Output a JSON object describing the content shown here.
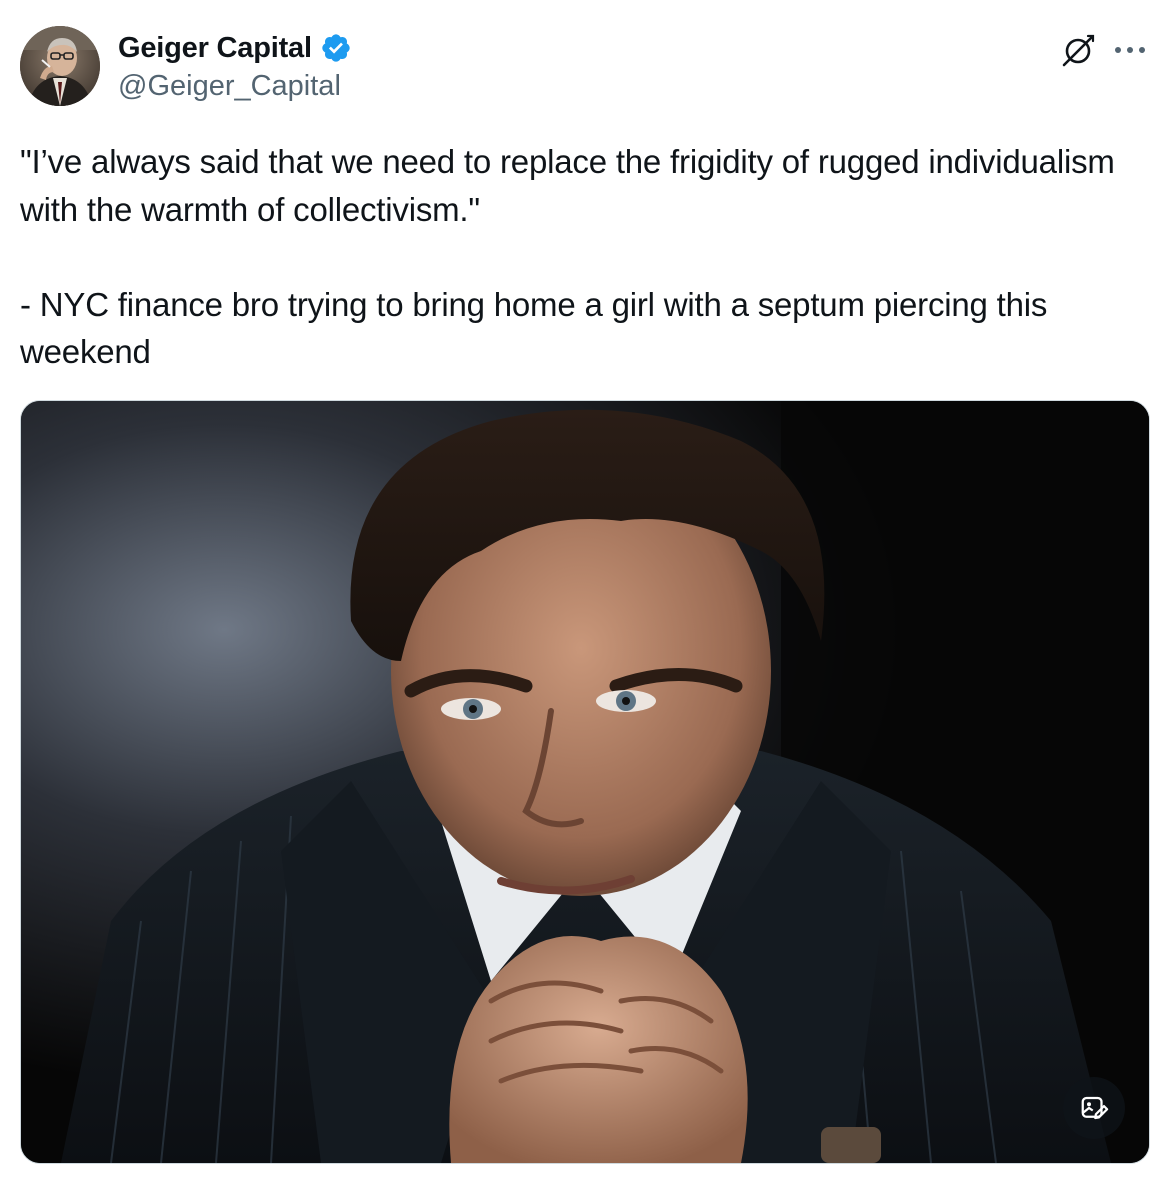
{
  "author": {
    "display_name": "Geiger Capital",
    "handle": "@Geiger_Capital",
    "verified": true,
    "verified_color": "#1d9bf0"
  },
  "header_actions": {
    "grok_icon": "grok-icon",
    "more_icon": "more-options-icon"
  },
  "tweet": {
    "text": "\"I’ve always said that we need to replace the frigidity of rugged individualism with the warmth of collectivism.\"\n\n- NYC finance bro trying to bring home a girl with a septum piercing this weekend"
  },
  "media": {
    "type": "photo",
    "alt_button_icon": "image-edit-icon"
  },
  "colors": {
    "text_primary": "#0f1419",
    "text_secondary": "#536471",
    "border": "#cfd9de"
  }
}
